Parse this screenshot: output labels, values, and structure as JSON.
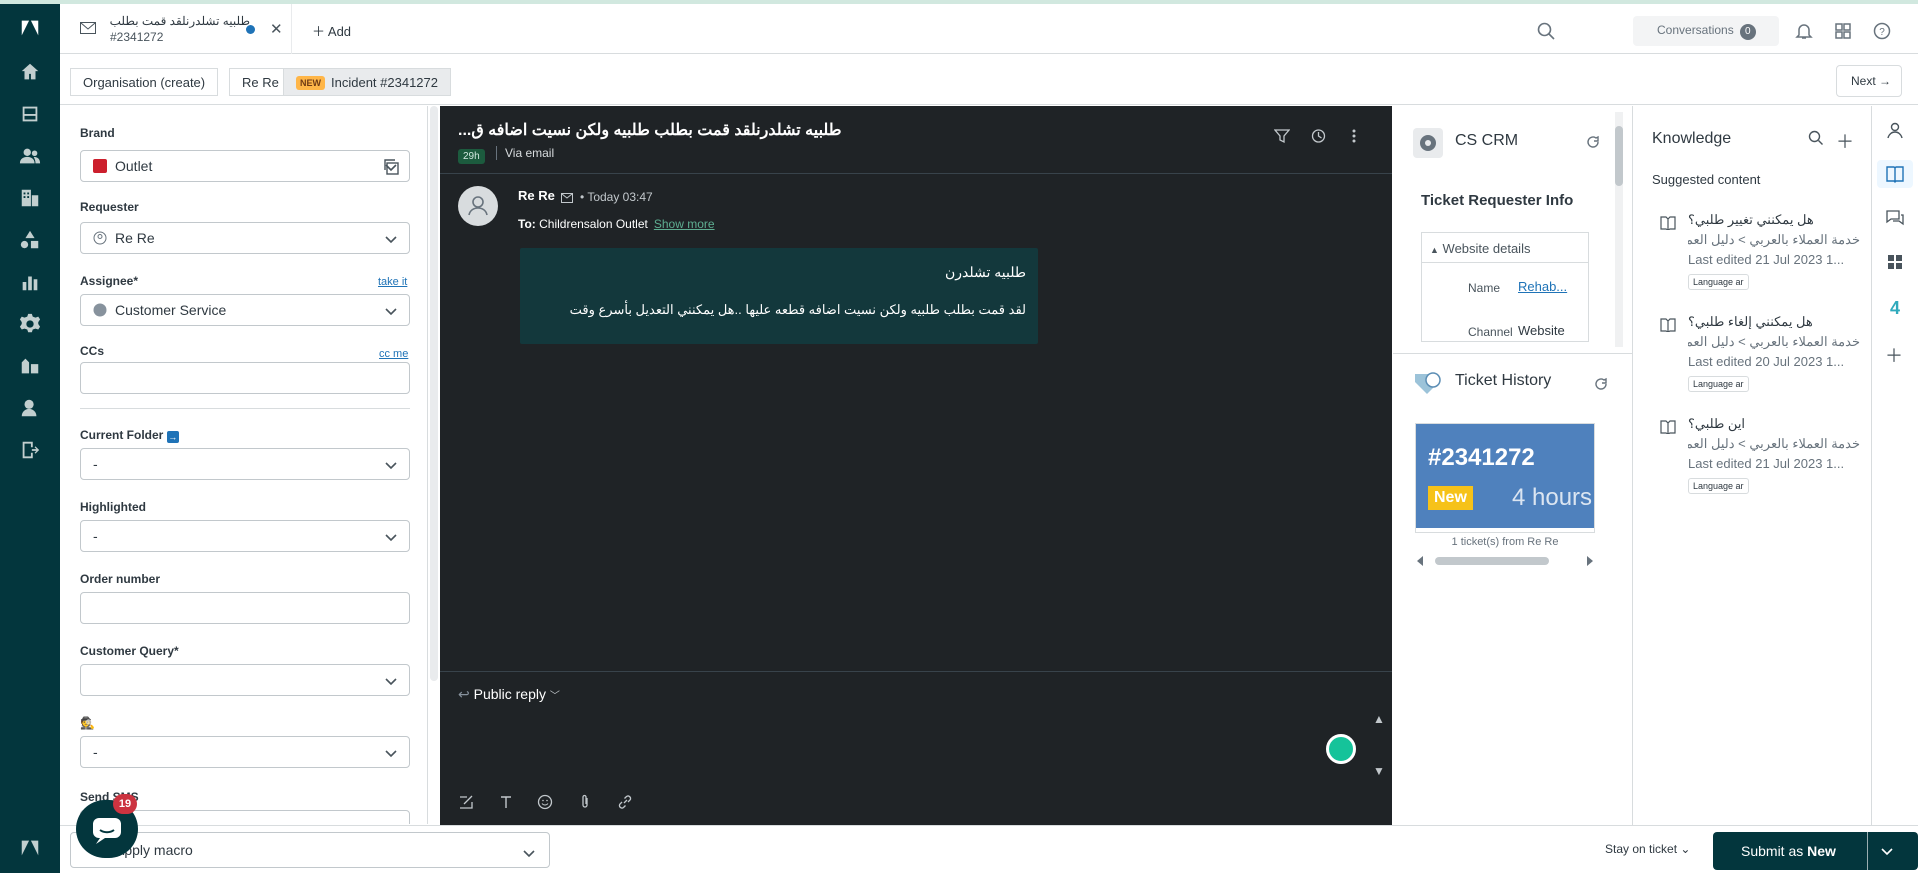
{
  "topbar": {
    "tab_title": "طلبيه تشلدرنلقد قمت بطلب طلبيه ولكن نسيت اضافه ق",
    "tab_id": "#2341272",
    "add_label": "Add",
    "conversations_label": "Conversations",
    "conversations_count": "0"
  },
  "breadcrumbs": {
    "org": "Organisation (create)",
    "requester": "Re Re",
    "new_badge": "NEW",
    "incident": "Incident #2341272",
    "next": "Next"
  },
  "form": {
    "brand_label": "Brand",
    "brand_value": "Outlet",
    "requester_label": "Requester",
    "requester_value": "Re Re",
    "assignee_label": "Assignee*",
    "take_it": "take it",
    "assignee_value": "Customer Service",
    "ccs_label": "CCs",
    "cc_me": "cc me",
    "folder_label": "Current Folder",
    "folder_value": "-",
    "highlighted_label": "Highlighted",
    "highlighted_value": "-",
    "order_label": "Order number",
    "query_label": "Customer Query*",
    "spy_value": "-",
    "sms_label": "Send SMS"
  },
  "bottombar": {
    "macro_placeholder": "Apply macro",
    "stay": "Stay on ticket",
    "submit_prefix": "Submit as",
    "submit_status": "New",
    "chat_count": "19"
  },
  "conversation": {
    "title": "طلبيه تشلدرنلقد قمت بطلب طلبيه ولكن نسيت اضافه ق...",
    "age": "29h",
    "via": "Via email",
    "sender": "Re Re",
    "time": "Today 03:47",
    "to_label": "To:",
    "to_value": "Childrensalon Outlet",
    "show_more": "Show more",
    "line1": "طلبيه تشلدرن",
    "line2": "لقد قمت بطلب طلبيه ولكن نسيت اضافه قطعه عليها ..هل يمكنني التعديل بأسرع وقت",
    "reply_type": "Public reply"
  },
  "crm": {
    "title": "CS CRM",
    "requester_info": "Ticket Requester Info",
    "website_details": "Website details",
    "name_key": "Name",
    "name_value": "Rehab...",
    "channel_key": "Channel",
    "channel_value": "Website",
    "history_title": "Ticket History",
    "ticket_num": "#2341272",
    "ticket_status": "New",
    "ticket_age": "4 hours",
    "history_footer": "1 ticket(s) from Re Re"
  },
  "knowledge": {
    "title": "Knowledge",
    "subtitle": "Suggested content",
    "items": [
      {
        "q": "هل يمكنني تغيير طلبي؟",
        "path": "خدمة العملاء بالعربي > دليل العملاء",
        "edited": "Last edited 21 Jul 2023 1...",
        "lang": "Language ar"
      },
      {
        "q": "هل يمكنني إلغاء طلبي؟",
        "path": "خدمة العملاء بالعربي > دليل العملاء",
        "edited": "Last edited 20 Jul 2023 1...",
        "lang": "Language ar"
      },
      {
        "q": "اين طلبي؟",
        "path": "خدمة العملاء بالعربي > دليل العملاء",
        "edited": "Last edited 21 Jul 2023 1...",
        "lang": "Language ar"
      }
    ]
  },
  "colors": {
    "rail": "#03363d",
    "conversation_bg": "#1f2326",
    "message_bg": "#13383c",
    "accent": "#1f73b7",
    "new_badge": "#ffb648"
  }
}
